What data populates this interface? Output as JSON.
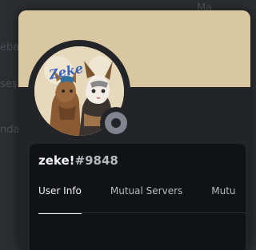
{
  "background": {
    "fragments": [
      "Ma",
      "eba",
      "ses",
      "nda"
    ]
  },
  "profile": {
    "username": "zeke!",
    "discriminator": "#9848",
    "avatar_text": "Zeke",
    "status": "offline",
    "banner_color": "#d9c7a2"
  },
  "tabs": [
    {
      "label": "User Info",
      "active": true
    },
    {
      "label": "Mutual Servers",
      "active": false
    },
    {
      "label": "Mutu",
      "active": false
    }
  ]
}
